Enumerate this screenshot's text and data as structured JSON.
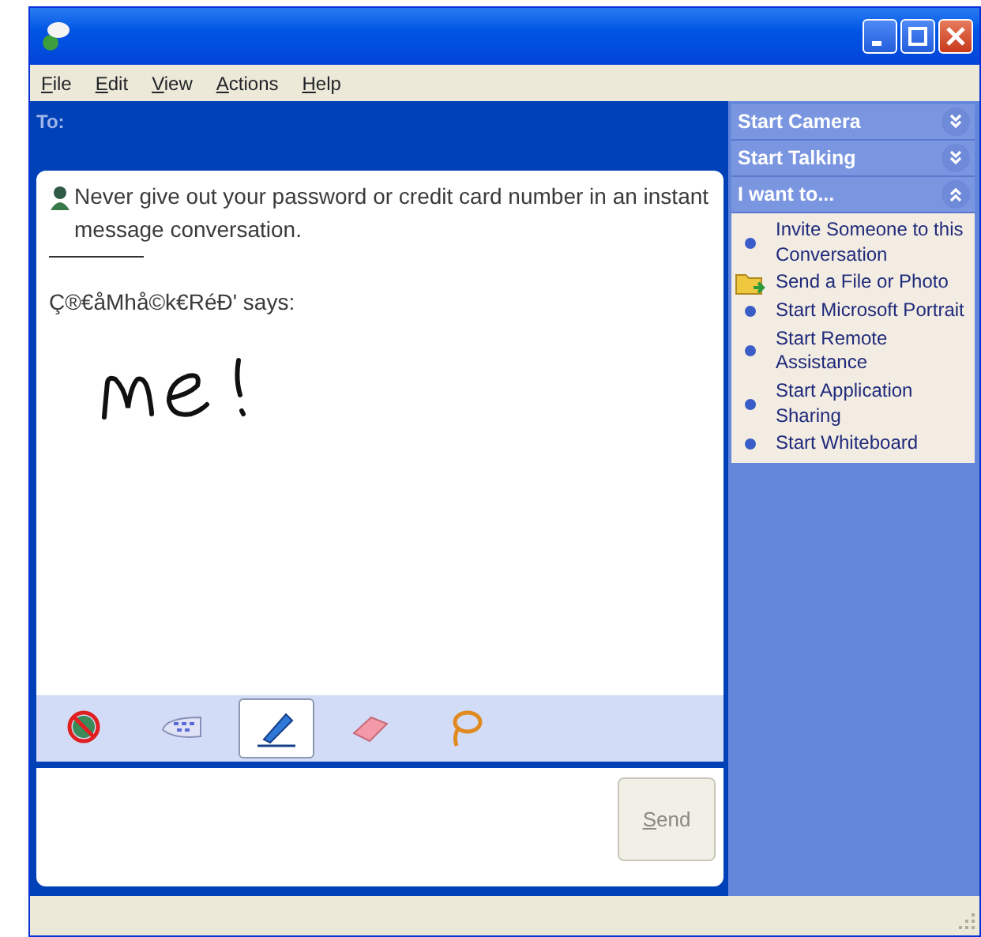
{
  "menu": [
    {
      "label": "File"
    },
    {
      "label": "Edit"
    },
    {
      "label": "View"
    },
    {
      "label": "Actions"
    },
    {
      "label": "Help"
    }
  ],
  "to_label": "To:",
  "conversation": {
    "warning": "Never give out your password or credit card number in an instant message conversation.",
    "sender": "Ç®€åMhå©k€RéÐ' says:"
  },
  "ink_tools": [
    {
      "kind": "block",
      "selected": false
    },
    {
      "kind": "keyboard",
      "selected": false
    },
    {
      "kind": "pen",
      "selected": true
    },
    {
      "kind": "eraser",
      "selected": false
    },
    {
      "kind": "lasso",
      "selected": false
    }
  ],
  "send_button": "Send",
  "sidebar": [
    {
      "title": "Start Camera",
      "expanded": false
    },
    {
      "title": "Start Talking",
      "expanded": false
    },
    {
      "title": "I want to...",
      "expanded": true,
      "items": [
        {
          "kind": "bullet",
          "label": "Invite Someone to this Conversation"
        },
        {
          "kind": "folder",
          "label": "Send a File or Photo"
        },
        {
          "kind": "bullet",
          "label": "Start Microsoft Portrait"
        },
        {
          "kind": "bullet",
          "label": "Start Remote Assistance"
        },
        {
          "kind": "bullet",
          "label": "Start Application Sharing"
        },
        {
          "kind": "bullet",
          "label": "Start Whiteboard"
        }
      ]
    }
  ]
}
